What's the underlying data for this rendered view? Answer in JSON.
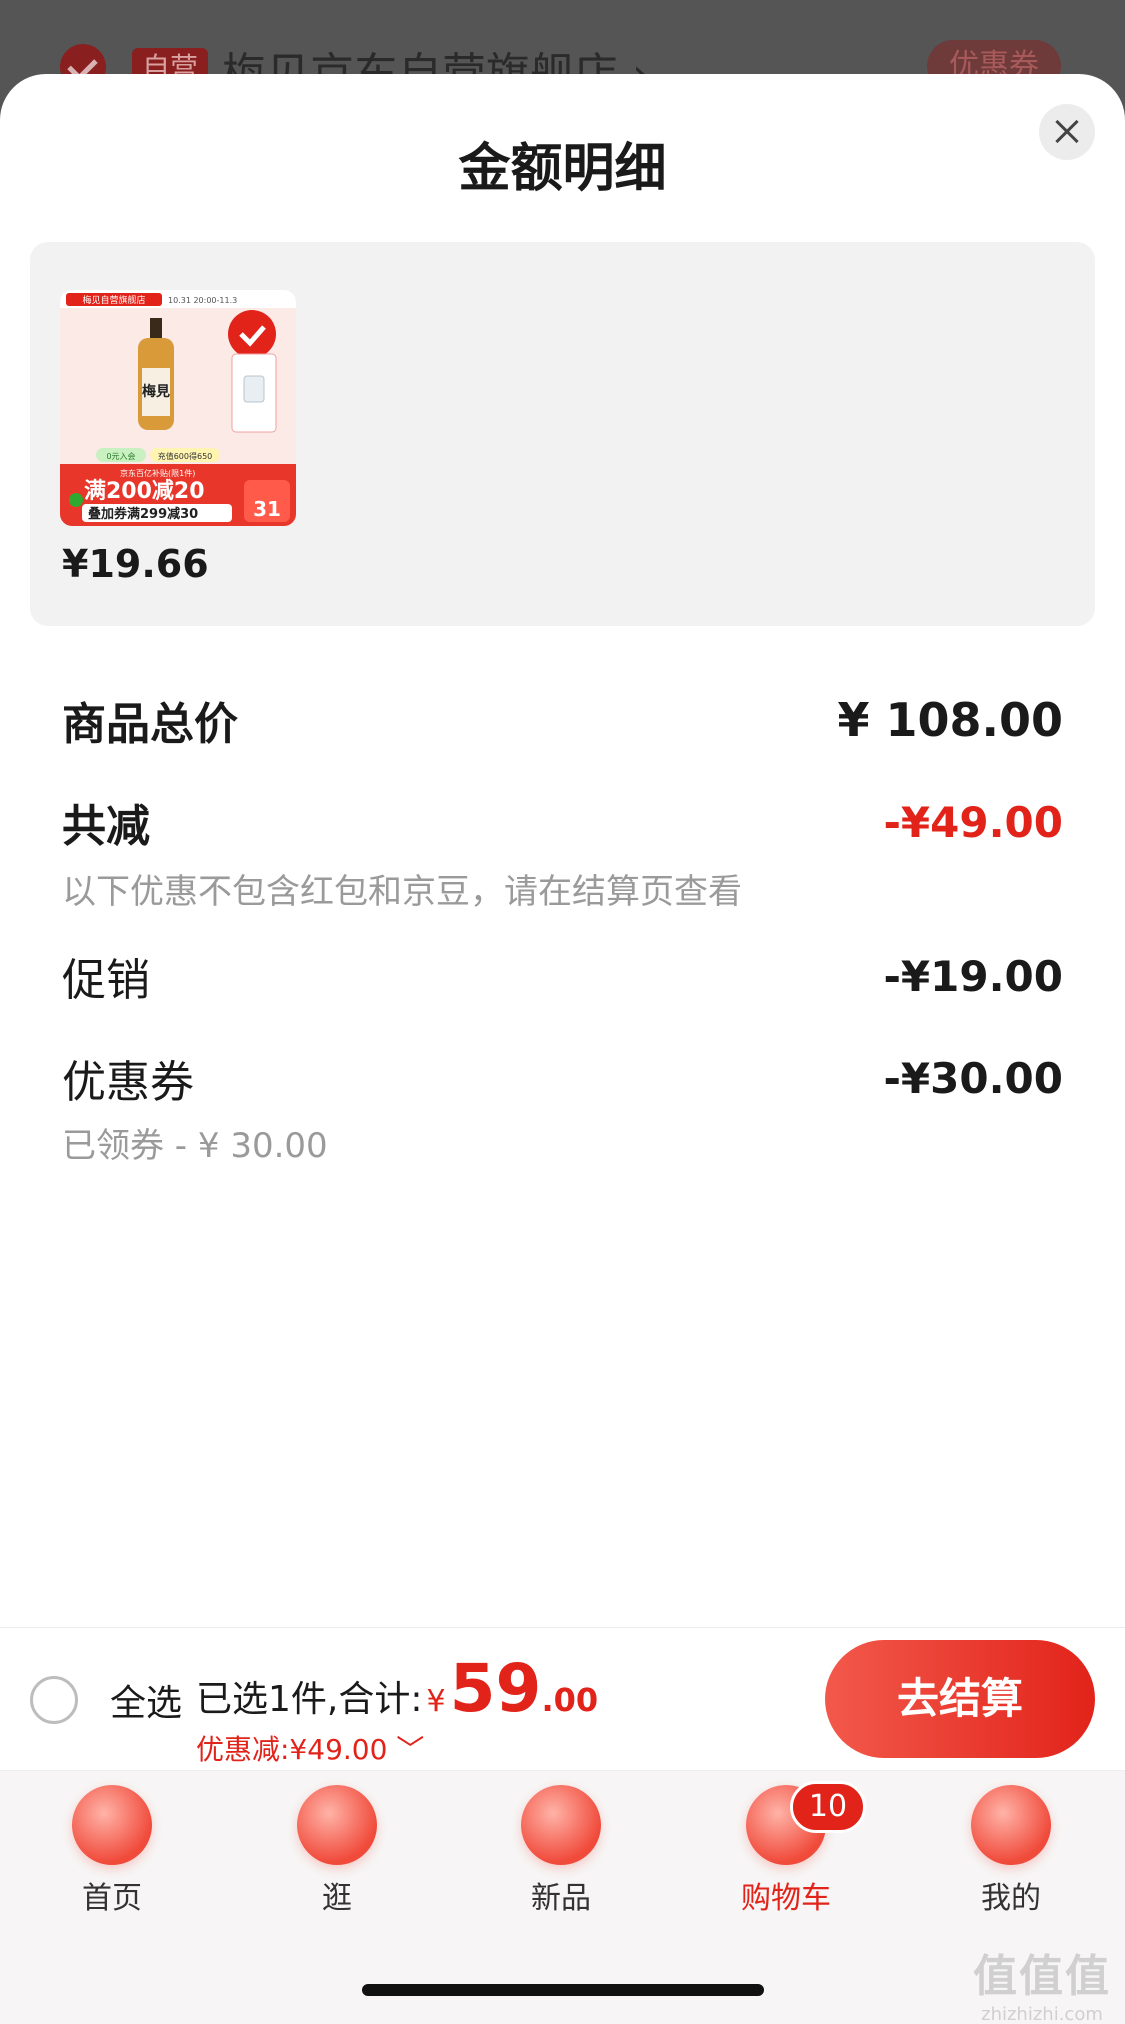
{
  "background": {
    "badge": "自营",
    "store_name": "梅见京东自营旗舰店 ›",
    "coupon_button": "优惠券"
  },
  "sheet": {
    "title": "金额明细",
    "close_icon": "close-icon"
  },
  "product": {
    "price": "¥19.66",
    "thumbnail": {
      "top_tag": "梅见自营旗舰店",
      "date_text": "10.31 20:00-11.3",
      "brand_text": "梅見",
      "promo_left": "0元入会",
      "promo_right": "充值600得650",
      "banner_small": "京东百亿补贴(限1件)",
      "promo_main": "满200减20",
      "promo_stack": "叠加券满299减30",
      "side_price": "31"
    }
  },
  "breakdown": {
    "total_label": "商品总价",
    "total_value": "¥ 108.00",
    "reduction_label": "共减",
    "reduction_value": "-¥49.00",
    "reduction_note": "以下优惠不包含红包和京豆，请在结算页查看",
    "promo_label": "促销",
    "promo_value": "-¥19.00",
    "coupon_label": "优惠券",
    "coupon_value": "-¥30.00",
    "coupon_note": "已领券 - ¥ 30.00"
  },
  "checkout": {
    "select_all": "全选",
    "selected_text": "已选1件,合计:",
    "currency": "¥",
    "total_integer": "59",
    "total_decimal": ".00",
    "discount_text": "优惠减:¥49.00 ﹀",
    "button_label": "去结算"
  },
  "tabbar": {
    "tabs": [
      {
        "label": "首页",
        "icon": "home-icon"
      },
      {
        "label": "逛",
        "icon": "browse-icon"
      },
      {
        "label": "新品",
        "icon": "new-products-icon"
      },
      {
        "label": "购物车",
        "icon": "cart-icon",
        "active": true
      },
      {
        "label": "我的",
        "icon": "profile-icon"
      }
    ],
    "cart_badge": "10"
  },
  "watermark": {
    "line1": "值值值",
    "line2": "zhizhizhi.com"
  },
  "colors": {
    "accent_red": "#e2231a",
    "muted_gray": "#9a9a9a",
    "panel_gray": "#f2f2f2"
  }
}
